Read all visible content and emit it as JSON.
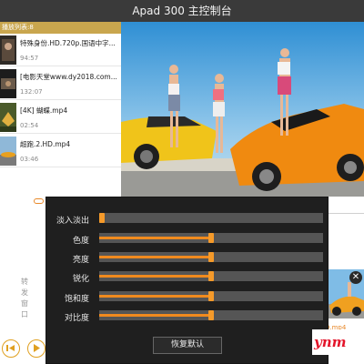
{
  "window": {
    "title": "Apad 300 主控制台"
  },
  "playlist": {
    "header": "播放列表:8",
    "items": [
      {
        "title": "特殊身份.HD.720p.国语中字...",
        "duration": "94:57"
      },
      {
        "title": "[电影天堂www.dy2018.com...",
        "duration": "132:07"
      },
      {
        "title": "[4K] 蝴蝶.mp4",
        "duration": "02:54"
      },
      {
        "title": "超跑.2.HD.mp4",
        "duration": "03:46"
      }
    ]
  },
  "side": {
    "vertical_label": "转发窗口",
    "mini_label": "D.mp4"
  },
  "adjust_panel": {
    "rows": [
      {
        "label": "淡入淡出",
        "value": 0.0
      },
      {
        "label": "色度",
        "value": 0.5
      },
      {
        "label": "亮度",
        "value": 0.5
      },
      {
        "label": "锐化",
        "value": 0.5
      },
      {
        "label": "饱和度",
        "value": 0.5
      },
      {
        "label": "对比度",
        "value": 0.5
      }
    ],
    "reset_label": "恢复默认"
  },
  "watermark": "ynm",
  "colors": {
    "accent": "#f08a1e",
    "header_gold": "#c9a64e",
    "panel_bg": "#1f1f1f",
    "titlebar": "#3a3a3a"
  },
  "icons": [
    "previous-icon",
    "play-icon",
    "close-icon"
  ]
}
